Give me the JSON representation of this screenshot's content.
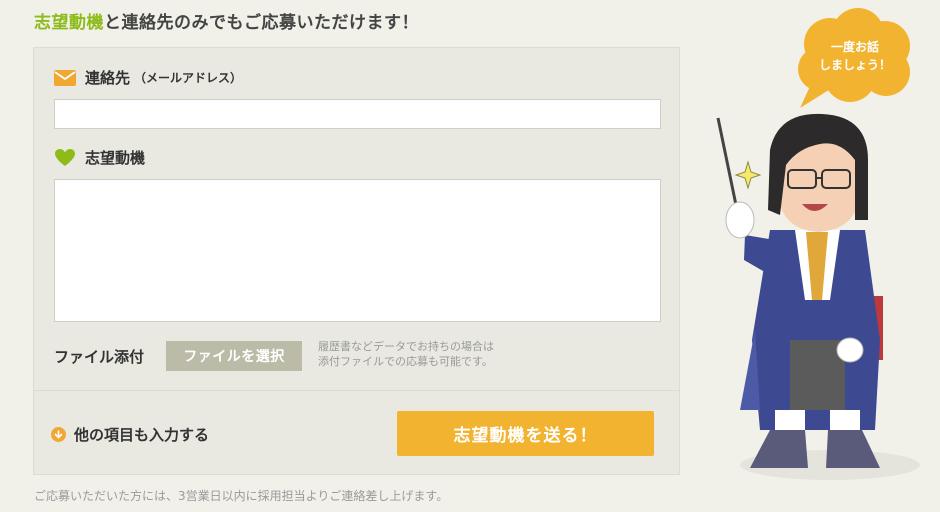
{
  "headline": {
    "highlight": "志望動機",
    "rest": "と連絡先のみでもご応募いただけます！"
  },
  "form": {
    "contact_label": "連絡先",
    "contact_sub": "（メールアドレス）",
    "contact_value": "",
    "motivation_label": "志望動機",
    "motivation_value": "",
    "file_label": "ファイル添付",
    "file_button": "ファイルを選択",
    "file_note_line1": "履歴書などデータでお持ちの場合は",
    "file_note_line2": "添付ファイルでの応募も可能です。",
    "more_link": "他の項目も入力する",
    "submit": "志望動機を送る！"
  },
  "footnote": "ご応募いただいた方には、3営業日以内に採用担当よりご連絡差し上げます。",
  "speech": {
    "line1": "一度お話",
    "line2": "しましょう！"
  },
  "colors": {
    "accent_green": "#8dbb1a",
    "accent_orange": "#f2b331",
    "file_button_gray": "#bbbba8"
  },
  "icons": {
    "contact": "mail-icon",
    "motivation": "heart-icon",
    "more": "arrow-down-circle-icon"
  }
}
